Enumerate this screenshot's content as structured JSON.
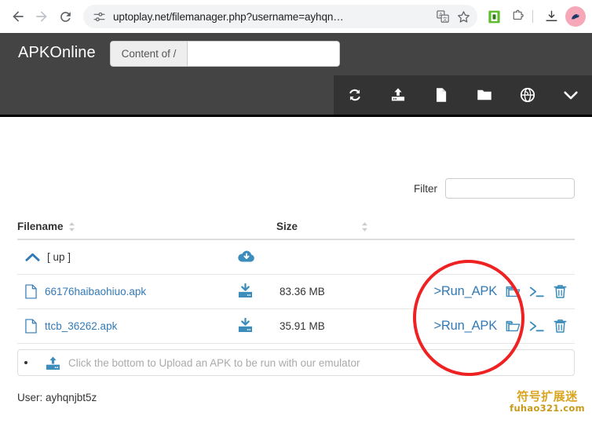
{
  "browser": {
    "back_label": "Back",
    "forward_label": "Forward",
    "reload_label": "Reload",
    "site_settings_label": "View site information",
    "url": "uptoplay.net/filemanager.php?username=ayhqn…",
    "translate_label": "Translate this page",
    "bookmark_label": "Bookmark this tab",
    "extension_label": "Extension",
    "extensions_label": "Extensions",
    "downloads_label": "Downloads",
    "profile_label": "Profile"
  },
  "header": {
    "brand": "APKOnline",
    "path_addon": "Content of /",
    "path_value": "",
    "path_placeholder": "",
    "toolbar": [
      {
        "name": "refresh-icon",
        "title": "Refresh"
      },
      {
        "name": "upload-icon",
        "title": "Upload"
      },
      {
        "name": "new-file-icon",
        "title": "New file"
      },
      {
        "name": "new-folder-icon",
        "title": "New folder"
      },
      {
        "name": "globe-icon",
        "title": "Remote"
      },
      {
        "name": "chevron-down-icon",
        "title": "More"
      }
    ]
  },
  "filter": {
    "label": "Filter",
    "value": "",
    "placeholder": ""
  },
  "table": {
    "columns": {
      "filename": "Filename",
      "size": "Size"
    },
    "up_row": {
      "label": "[ up ]",
      "download_icon": "cloud-download-icon"
    },
    "rows": [
      {
        "filename": "66176haibaohiuo.apk",
        "size": "83.36 MB",
        "run_label": ">Run_APK",
        "download_icon": "download-icon",
        "rename_icon": "rename-icon",
        "terminal_label": ">_",
        "delete_icon": "trash-icon"
      },
      {
        "filename": "ttcb_36262.apk",
        "size": "35.91 MB",
        "run_label": ">Run_APK",
        "download_icon": "download-icon",
        "rename_icon": "rename-icon",
        "terminal_label": ">_",
        "delete_icon": "trash-icon"
      }
    ]
  },
  "upload": {
    "text": "Click the bottom to Upload an APK to be run with our emulator",
    "icon": "upload-icon"
  },
  "footer": {
    "user": "User: ayhqnjbt5z"
  },
  "annotation": {
    "shape": "ellipse",
    "color": "#ee2222"
  },
  "watermark": {
    "cn": "符号扩展迷",
    "en": "fuhao321.com"
  },
  "colors": {
    "header_bg": "#444444",
    "toolbar_bg": "#333333",
    "link": "#337ab7",
    "annotation": "#ee2222",
    "watermark": "#d9a520"
  }
}
